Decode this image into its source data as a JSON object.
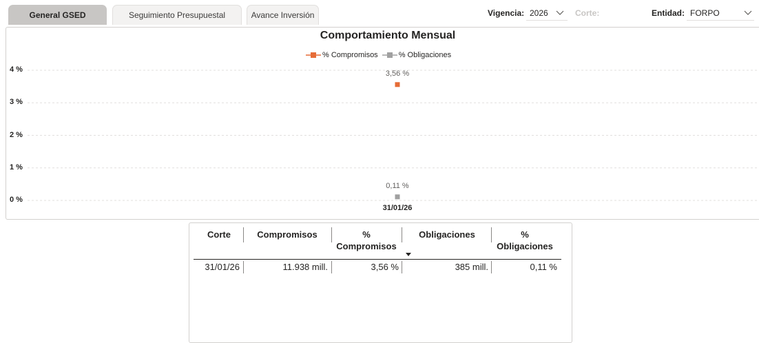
{
  "tabs": [
    {
      "label": "General GSED",
      "active": true
    },
    {
      "label": "Seguimiento Presupuestal",
      "active": false
    },
    {
      "label": "Avance Inversión",
      "active": false
    }
  ],
  "filters": {
    "vigencia": {
      "label": "Vigencia:",
      "value": "2026"
    },
    "corte": {
      "label": "Corte:"
    },
    "entidad": {
      "label": "Entidad:",
      "value": "FORPO"
    }
  },
  "chart_data": {
    "type": "line",
    "title": "Comportamiento Mensual",
    "categories": [
      "31/01/26"
    ],
    "y_ticks": [
      "0 %",
      "1 %",
      "2 %",
      "3 %",
      "4 %"
    ],
    "ylim": [
      0,
      4
    ],
    "grid": true,
    "legend_position": "top-center",
    "series": [
      {
        "name": "% Compromisos",
        "values": [
          3.56
        ],
        "labels": [
          "3,56 %"
        ],
        "color": "#e66c37"
      },
      {
        "name": "% Obligaciones",
        "values": [
          0.11
        ],
        "labels": [
          "0,11 %"
        ],
        "color": "#a0a0a0"
      }
    ]
  },
  "table": {
    "headers": [
      "Corte",
      "Compromisos",
      "% Compromisos",
      "Obligaciones",
      "% Obligaciones"
    ],
    "rows": [
      [
        "31/01/26",
        "11.938 mill.",
        "3,56 %",
        "385 mill.",
        "0,11 %"
      ]
    ]
  }
}
